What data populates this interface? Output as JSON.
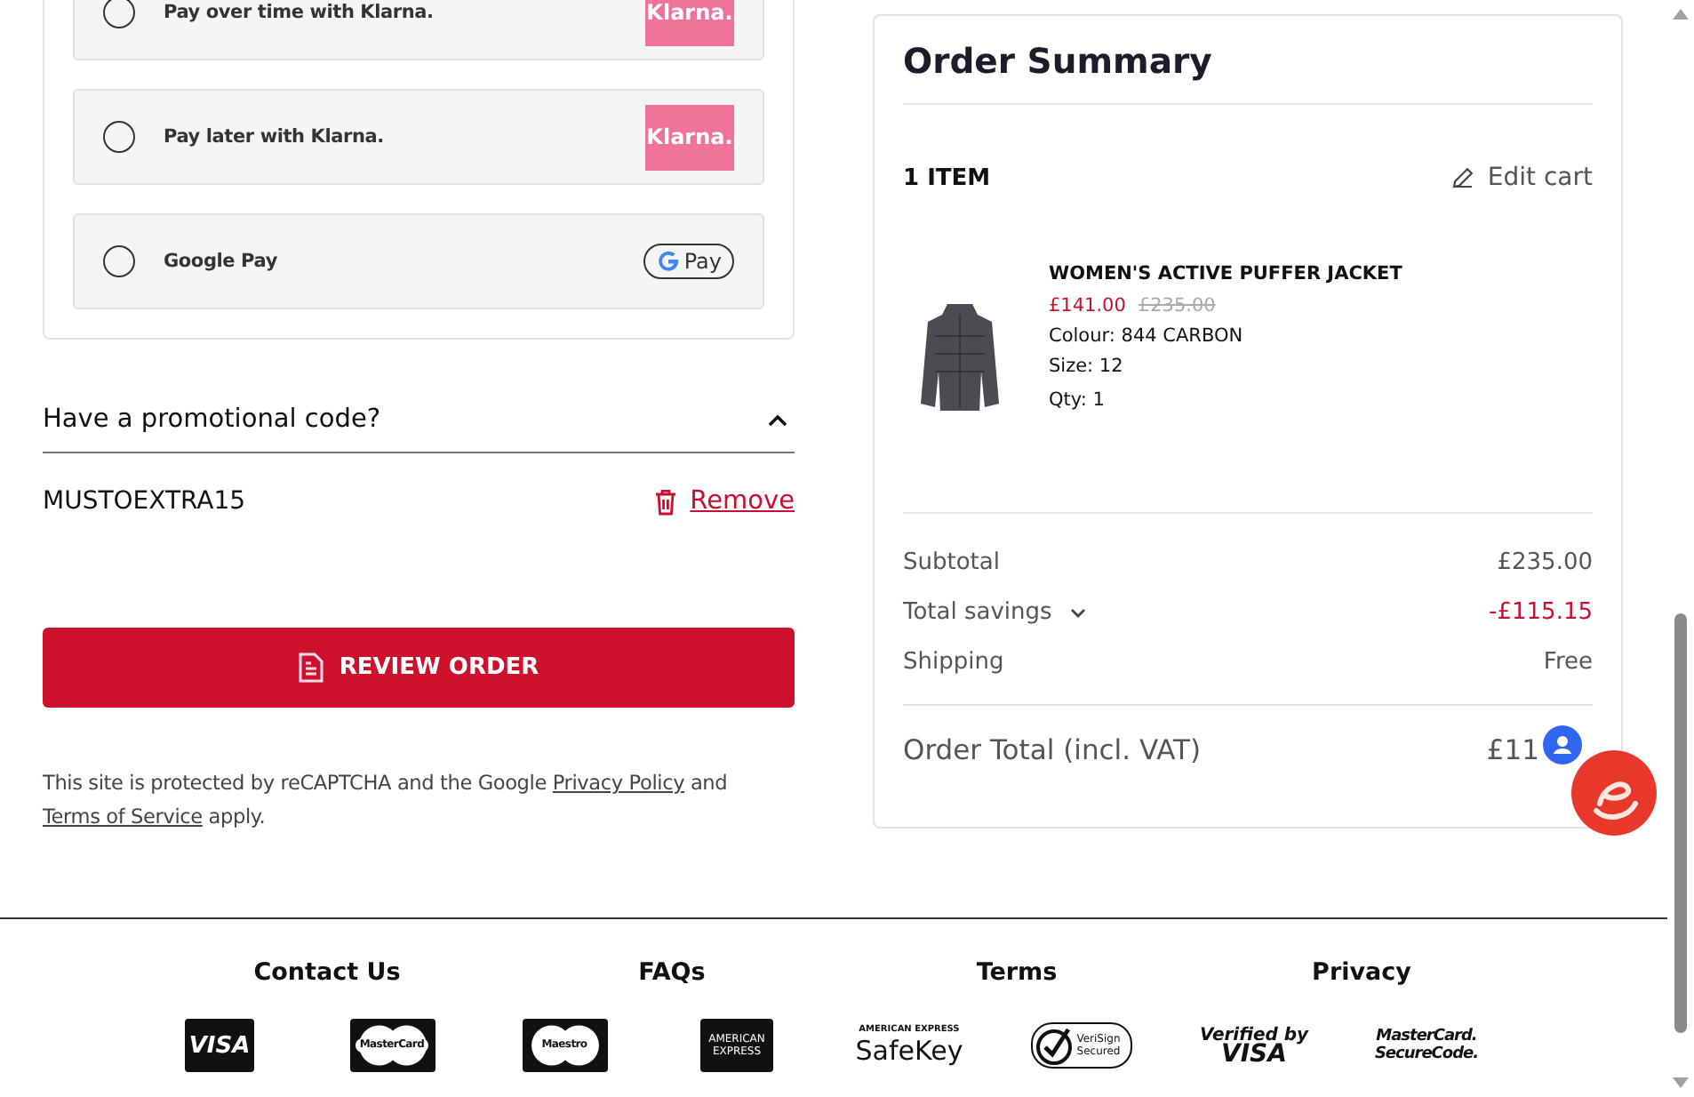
{
  "payment_options": [
    {
      "label": "Pay over time with Klarna.",
      "selected": false,
      "badge": {
        "kind": "klarna",
        "text": "Klarna."
      }
    },
    {
      "label": "Pay later with Klarna.",
      "selected": false,
      "badge": {
        "kind": "klarna",
        "text": "Klarna."
      }
    },
    {
      "label": "Google Pay",
      "selected": false,
      "badge": {
        "kind": "gpay",
        "text": "Pay"
      }
    }
  ],
  "promo": {
    "title": "Have a promotional code?",
    "expanded": true,
    "code": "MUSTOEXTRA15",
    "remove_label": "Remove"
  },
  "review_button": "REVIEW ORDER",
  "recaptcha": {
    "before": "This site is protected by reCAPTCHA and the Google",
    "privacy_link": "Privacy Policy",
    "middle": "and",
    "terms_link": "Terms of Service",
    "after": "apply."
  },
  "order_summary": {
    "title": "Order Summary",
    "item_count": "1 ITEM",
    "edit_label": "Edit cart",
    "items": [
      {
        "name": "WOMEN'S ACTIVE PUFFER JACKET",
        "price": "£141.00",
        "was_price": "£235.00",
        "colour": "Colour: 844 CARBON",
        "size": "Size: 12",
        "qty": "Qty: 1"
      }
    ],
    "totals": [
      {
        "label": "Subtotal",
        "value": "£235.00",
        "kind": "plain"
      },
      {
        "label": "Total savings",
        "value": "-£115.15",
        "kind": "saving"
      },
      {
        "label": "Shipping",
        "value": "Free",
        "kind": "plain"
      }
    ],
    "order_total": {
      "label": "Order Total (incl. VAT)",
      "value": "£11"
    }
  },
  "footer": {
    "links": [
      "Contact Us",
      "FAQs",
      "Terms",
      "Privacy"
    ],
    "logos": [
      {
        "kind": "visa",
        "lines": [
          "VISA"
        ]
      },
      {
        "kind": "mastercard",
        "lines": [
          "MasterCard"
        ]
      },
      {
        "kind": "maestro",
        "lines": [
          "Maestro"
        ]
      },
      {
        "kind": "amex",
        "lines": [
          "AMERICAN",
          "EXPRESS"
        ]
      },
      {
        "kind": "safekey",
        "lines": [
          "AMERICAN EXPRESS",
          "SafeKey"
        ]
      },
      {
        "kind": "verisign",
        "lines": [
          "VeriSign",
          "Secured"
        ]
      },
      {
        "kind": "vbv",
        "lines": [
          "Verified by",
          "VISA"
        ]
      },
      {
        "kind": "securecode",
        "lines": [
          "MasterCard.",
          "SecureCode."
        ]
      }
    ]
  }
}
